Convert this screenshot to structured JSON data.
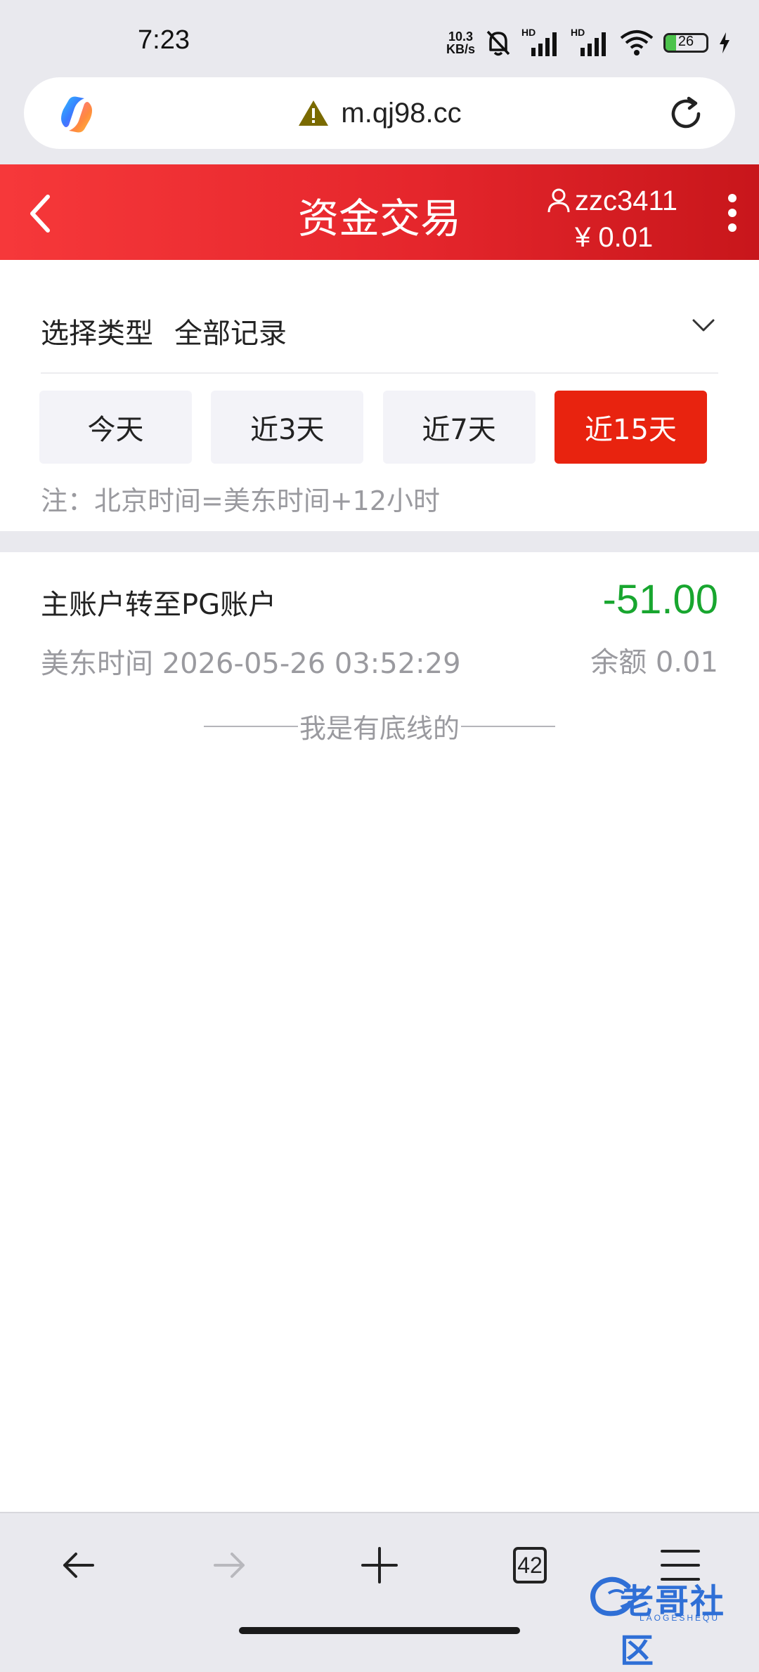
{
  "status_bar": {
    "time": "7:23",
    "net_speed_value": "10.3",
    "net_speed_unit": "KB/s",
    "sim1_label": "HD",
    "sim2_label": "HD",
    "battery_level": "26",
    "battery_fraction": 0.26,
    "icons": [
      "mute-bell-icon",
      "signal-icon",
      "signal-icon",
      "wifi-icon",
      "battery-icon",
      "charging-icon"
    ]
  },
  "browser": {
    "url": "m.qj98.cc",
    "tabs_count": "42",
    "security_warning_color": "#7a6a00",
    "nav_icons": [
      "back-arrow-icon",
      "forward-arrow-icon",
      "plus-icon",
      "tabs-icon",
      "menu-icon"
    ]
  },
  "header": {
    "title": "资金交易",
    "username": "zzc3411",
    "balance": "¥ 0.01"
  },
  "filter": {
    "type_label": "选择类型",
    "type_value": "全部记录",
    "ranges": [
      {
        "label": "今天",
        "active": false
      },
      {
        "label": "近3天",
        "active": false
      },
      {
        "label": "近7天",
        "active": false
      },
      {
        "label": "近15天",
        "active": true
      }
    ],
    "note": "注：北京时间=美东时间+12小时"
  },
  "records": [
    {
      "title": "主账户转至PG账户",
      "amount": "-51.00",
      "time": "美东时间 2026-05-26 03:52:29",
      "balance": "余额 0.01"
    }
  ],
  "end_text": "我是有底线的",
  "watermark": {
    "text": "老哥社区",
    "sub": "LAOGESHEQU"
  },
  "colors": {
    "header_red": "#e5262c",
    "active_red": "#e8230f",
    "amount_green": "#18a62f",
    "muted_gray": "#9a9a9f"
  }
}
